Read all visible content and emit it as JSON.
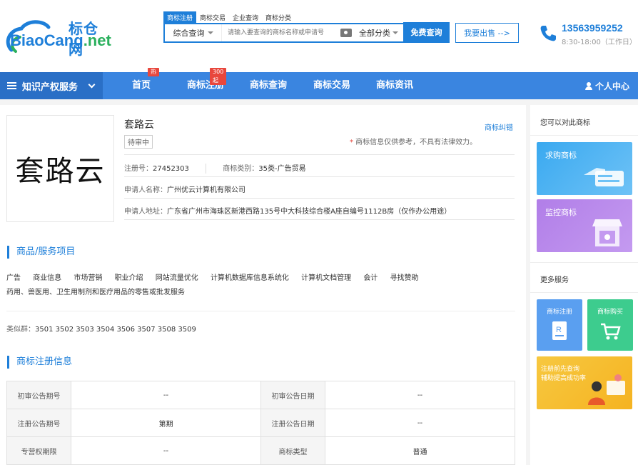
{
  "logo": {
    "cn": "标仓网",
    "en_main": "BiaoCang",
    "en_suffix": ".net"
  },
  "search": {
    "tabs": [
      "商标注册",
      "商标交易",
      "企业查询",
      "商标分类"
    ],
    "mode": "综合查询",
    "placeholder": "请输入要查询的商标名称或申请号",
    "category": "全部分类",
    "button": "免费查询"
  },
  "sell_button": "我要出售 -->",
  "contact": {
    "phone": "13563959252",
    "hours": "8:30-18:00（工作日）"
  },
  "nav": {
    "ip_menu": "知识产权服务",
    "items": [
      {
        "label": "首页",
        "badge": "热"
      },
      {
        "label": "商标注册",
        "badge": "300起"
      },
      {
        "label": "商标查询",
        "badge": ""
      },
      {
        "label": "商标交易",
        "badge": ""
      },
      {
        "label": "商标资讯",
        "badge": ""
      }
    ],
    "user": "个人中心"
  },
  "trademark": {
    "image_text": "套路云",
    "name": "套路云",
    "status": "待审中",
    "correct_link": "商标纠错",
    "note_star": "*",
    "note": " 商标信息仅供参考，不具有法律效力。",
    "reg_no_label": "注册号：",
    "reg_no": "27452303",
    "class_label": "商标类别：",
    "class": "35类-广告贸易",
    "applicant_label": "申请人名称：",
    "applicant": "广州优云计算机有限公司",
    "address_label": "申请人地址：",
    "address": "广东省广州市海珠区新港西路135号中大科技综合楼A座自编号1112B房（仅作办公用途）"
  },
  "goods": {
    "title": "商品/服务项目",
    "items": [
      "广告",
      "商业信息",
      "市场营销",
      "职业介绍",
      "网站流量优化",
      "计算机数据库信息系统化",
      "计算机文档管理",
      "会计",
      "寻找赞助"
    ],
    "item_line2": "药用、兽医用、卫生用制剂和医疗用品的零售或批发服务",
    "similar_label": "类似群：",
    "similar": "3501 3502 3503 3504 3506 3507 3508 3509"
  },
  "registration": {
    "title": "商标注册信息",
    "rows": [
      [
        "初审公告期号",
        "--",
        "初审公告日期",
        "--"
      ],
      [
        "注册公告期号",
        "第期",
        "注册公告日期",
        "--"
      ],
      [
        "专营权期限",
        "--",
        "商标类型",
        "普通"
      ]
    ]
  },
  "sidebar": {
    "compare_title": "您可以对此商标",
    "buy_card": "求购商标",
    "monitor_card": "监控商标",
    "more_title": "更多服务",
    "mini_reg": "商标注册",
    "mini_buy": "商标购买",
    "advice_line1": "注册前先查询",
    "advice_line2": "辅助提高成功率"
  },
  "colors": {
    "brand": "#1e7fd9",
    "nav": "#3a85e0",
    "badge": "#e8473d"
  }
}
